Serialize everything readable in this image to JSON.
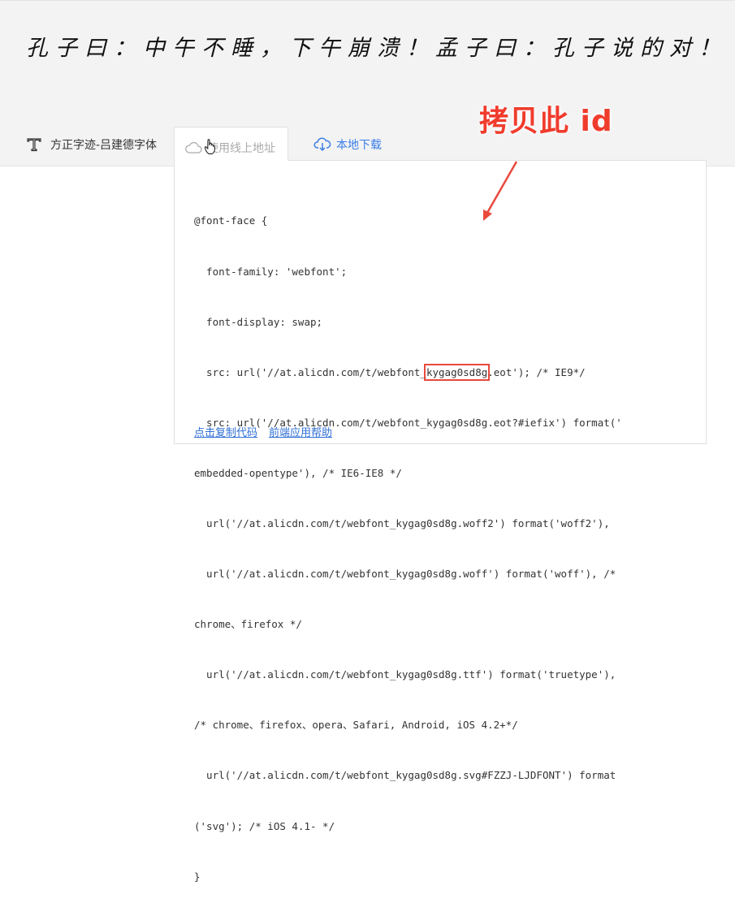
{
  "preview": {
    "text": "孔子曰：中午不睡，下午崩溃！孟子曰：孔子说的对！"
  },
  "annotation": {
    "text": "拷贝此 id"
  },
  "font": {
    "name": "方正字迹-吕建德字体",
    "icon": "font-icon"
  },
  "tabs": {
    "online_label": "使用线上地址",
    "download_label": "本地下载"
  },
  "code": {
    "lines": [
      "@font-face {",
      "  font-family: 'webfont';",
      "  font-display: swap;",
      "  src: url('//at.alicdn.com/t/webfont_kygag0sd8g.eot'); /* IE9*/",
      "  src: url('//at.alicdn.com/t/webfont_kygag0sd8g.eot?#iefix') format('",
      "embedded-opentype'), /* IE6-IE8 */",
      "  url('//at.alicdn.com/t/webfont_kygag0sd8g.woff2') format('woff2'),",
      "  url('//at.alicdn.com/t/webfont_kygag0sd8g.woff') format('woff'), /*",
      "chrome、firefox */",
      "  url('//at.alicdn.com/t/webfont_kygag0sd8g.ttf') format('truetype'),",
      "/* chrome、firefox、opera、Safari, Android, iOS 4.2+*/",
      "  url('//at.alicdn.com/t/webfont_kygag0sd8g.svg#FZZJ-LJDFONT') format",
      "('svg'); /* iOS 4.1- */",
      "}"
    ],
    "highlight_prefix": "  src: url('//at.alicdn.com/t/webfont_",
    "highlight_id": "kygag0sd8g",
    "highlight_suffix": ".eot'); /* IE9*/"
  },
  "links": {
    "copy_label": "点击复制代码",
    "help_label": "前端应用帮助"
  },
  "colors": {
    "accent": "#3a7ee8",
    "annotation": "#f03c2d"
  }
}
